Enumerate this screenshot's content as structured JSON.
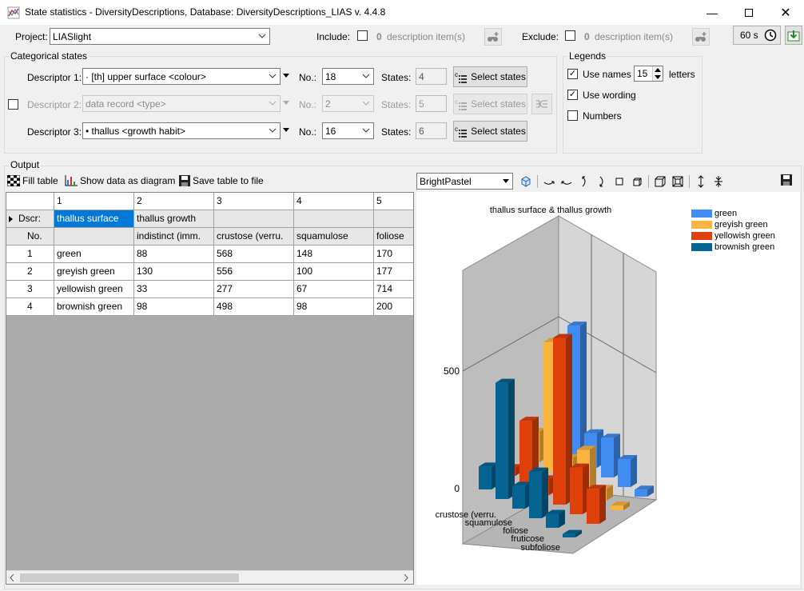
{
  "window": {
    "title": "State statistics - DiversityDescriptions,  Database: DiversityDescriptions_LIAS    v. 4.4.8"
  },
  "toolbar": {
    "project_label": "Project:",
    "project_value": "LIASlight",
    "include_label": "Include:",
    "include_count": "0",
    "include_items": "description item(s)",
    "exclude_label": "Exclude:",
    "exclude_count": "0",
    "exclude_items": "description item(s)",
    "timeout": "60 s"
  },
  "categorical": {
    "group_title": "Categorical states",
    "descriptors": [
      {
        "label": "Descriptor 1:",
        "value": "· [th] upper surface <colour>",
        "no_label": "No.:",
        "no": "18",
        "states_label": "States:",
        "states": "4",
        "select": "Select states",
        "enabled": true
      },
      {
        "label": "Descriptor 2:",
        "value": "data record <type>",
        "no_label": "No.:",
        "no": "2",
        "states_label": "States:",
        "states": "5",
        "select": "Select states",
        "enabled": false
      },
      {
        "label": "Descriptor 3:",
        "value": "• thallus <growth habit>",
        "no_label": "No.:",
        "no": "16",
        "states_label": "States:",
        "states": "6",
        "select": "Select states",
        "enabled": true
      }
    ]
  },
  "legends": {
    "group_title": "Legends",
    "use_names": "Use names",
    "letters_value": "15",
    "letters_label": "letters",
    "use_wording": "Use wording",
    "numbers": "Numbers"
  },
  "output": {
    "group_title": "Output",
    "fill_table": "Fill table",
    "show_diagram": "Show data as diagram",
    "save_table": "Save table to file",
    "palette": "BrightPastel"
  },
  "table": {
    "col_numbers": [
      "1",
      "2",
      "3",
      "4",
      "5"
    ],
    "dscr_label": "Dscr:",
    "no_label": "No.",
    "dscr_row": [
      "thallus surface",
      "thallus growth",
      "",
      "",
      ""
    ],
    "state_row": [
      "",
      "indistinct (imm.",
      "crustose (verru.",
      "squamulose",
      "foliose"
    ],
    "rows": [
      {
        "no": "1",
        "name": "green",
        "values": [
          "88",
          "568",
          "148",
          "170"
        ]
      },
      {
        "no": "2",
        "name": "greyish green",
        "values": [
          "130",
          "556",
          "100",
          "177"
        ]
      },
      {
        "no": "3",
        "name": "yellowish green",
        "values": [
          "33",
          "277",
          "67",
          "714"
        ]
      },
      {
        "no": "4",
        "name": "brownish green",
        "values": [
          "98",
          "498",
          "98",
          "200"
        ]
      }
    ]
  },
  "chart_data": {
    "type": "bar",
    "title": "thallus surface & thallus growth",
    "categories": [
      "indistinct (imm.",
      "crustose (verru.",
      "squamulose",
      "foliose",
      "fruticose",
      "subfoliose"
    ],
    "series": [
      {
        "name": "green",
        "color": "#418cf0",
        "values": [
          88,
          568,
          148,
          170,
          120,
          30
        ]
      },
      {
        "name": "greyish green",
        "color": "#fcb441",
        "values": [
          130,
          556,
          100,
          177,
          50,
          20
        ]
      },
      {
        "name": "yellowish green",
        "color": "#e0400a",
        "values": [
          33,
          277,
          67,
          714,
          200,
          150
        ]
      },
      {
        "name": "brownish green",
        "color": "#056492",
        "values": [
          98,
          498,
          98,
          200,
          60,
          15
        ]
      }
    ],
    "ylim": [
      0,
      1000
    ],
    "yticks": [
      "0",
      "500"
    ],
    "legend": "top-right",
    "style": "3d"
  }
}
